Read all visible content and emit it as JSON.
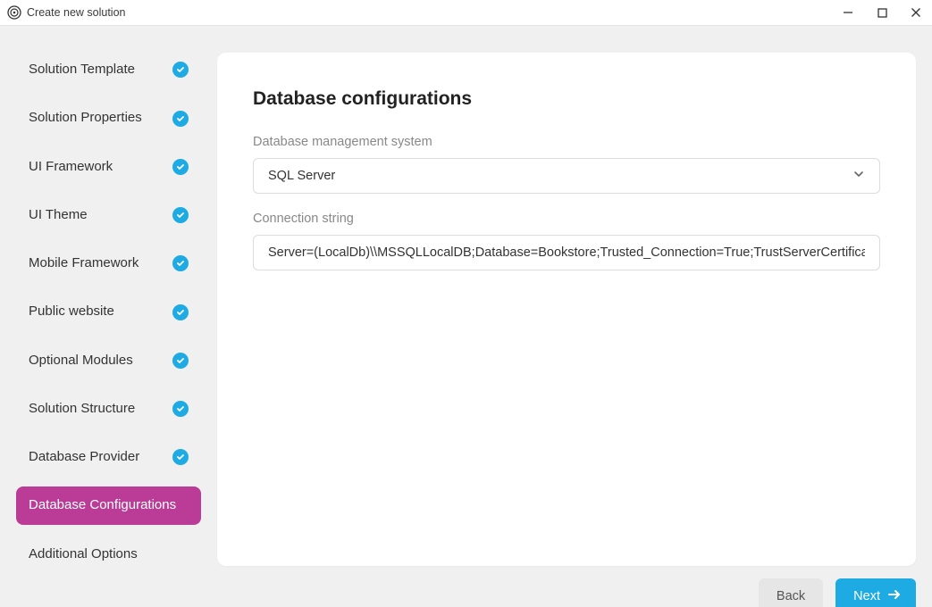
{
  "window": {
    "title": "Create new solution"
  },
  "sidebar": {
    "items": [
      {
        "label": "Solution Template",
        "completed": true,
        "active": false
      },
      {
        "label": "Solution Properties",
        "completed": true,
        "active": false
      },
      {
        "label": "UI Framework",
        "completed": true,
        "active": false
      },
      {
        "label": "UI Theme",
        "completed": true,
        "active": false
      },
      {
        "label": "Mobile Framework",
        "completed": true,
        "active": false
      },
      {
        "label": "Public website",
        "completed": true,
        "active": false
      },
      {
        "label": "Optional Modules",
        "completed": true,
        "active": false
      },
      {
        "label": "Solution Structure",
        "completed": true,
        "active": false
      },
      {
        "label": "Database Provider",
        "completed": true,
        "active": false
      },
      {
        "label": "Database Configurations",
        "completed": false,
        "active": true
      },
      {
        "label": "Additional Options",
        "completed": false,
        "active": false
      }
    ]
  },
  "main": {
    "title": "Database configurations",
    "dbms_label": "Database management system",
    "dbms_value": "SQL Server",
    "connstr_label": "Connection string",
    "connstr_value": "Server=(LocalDb)\\\\MSSQLLocalDB;Database=Bookstore;Trusted_Connection=True;TrustServerCertificate=true"
  },
  "footer": {
    "back_label": "Back",
    "next_label": "Next"
  },
  "colors": {
    "accent_purple": "#ba3c96",
    "accent_blue": "#1eabe4"
  }
}
